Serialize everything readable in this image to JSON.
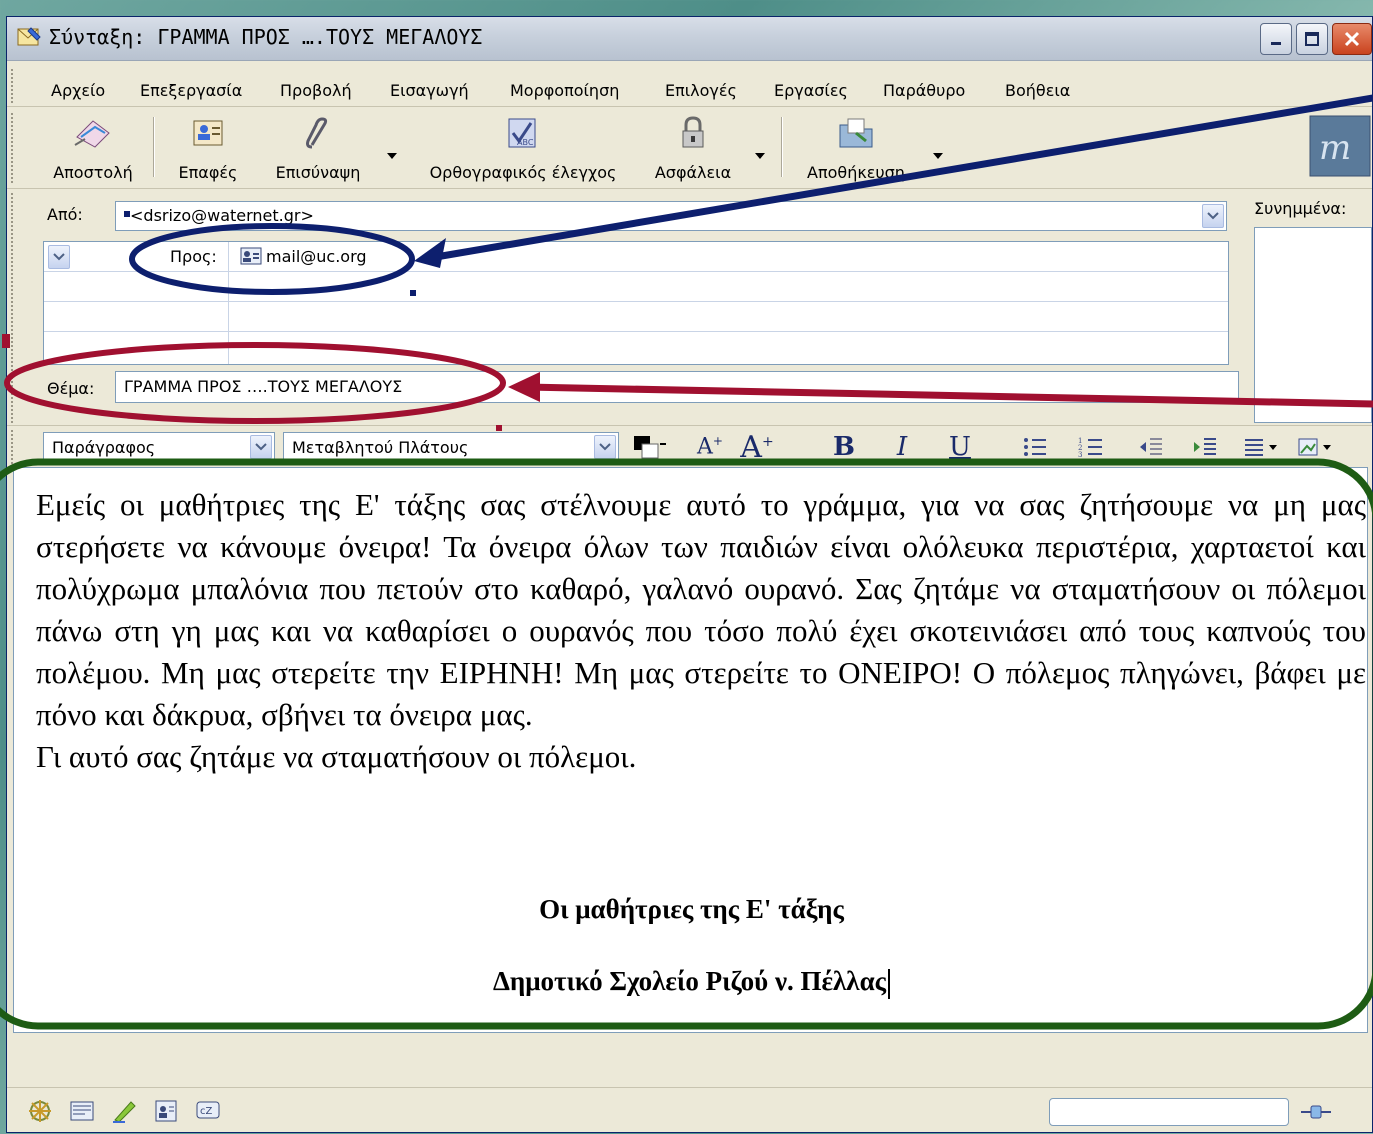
{
  "window": {
    "title": "Σύνταξη: ΓΡΑΜΜΑ ΠΡΟΣ ….ΤΟΥΣ ΜΕΓΑΛΟΥΣ"
  },
  "menu": [
    "Αρχείο",
    "Επεξεργασία",
    "Προβολή",
    "Εισαγωγή",
    "Μορφοποίηση",
    "Επιλογές",
    "Εργασίες",
    "Παράθυρο",
    "Βοήθεια"
  ],
  "toolbar": {
    "send": "Αποστολή",
    "contacts": "Επαφές",
    "attach": "Επισύναψη",
    "spell": "Ορθογραφικός έλεγχος",
    "security": "Ασφάλεια",
    "save": "Αποθήκευση"
  },
  "header": {
    "from_label": "Από:",
    "from_value": "<dsrizo@waternet.gr>",
    "to_label": "Προς:",
    "to_value": "mail@uc.org",
    "subject_label": "Θέμα:",
    "subject_value": "ΓΡΑΜΜΑ ΠΡΟΣ ….ΤΟΥΣ ΜΕΓΑΛΟΥΣ",
    "attachments_label": "Συνημμένα:"
  },
  "format": {
    "paragraph": "Παράγραφος",
    "font": "Μεταβλητού Πλάτους"
  },
  "body": {
    "text": "Εμείς οι μαθήτριες της Ε' τάξης σας στέλνουμε αυτό το γράμμα, για να σας ζητήσουμε να μη μας στερήσετε να κάνουμε όνειρα! Τα όνειρα όλων των παιδιών είναι ολόλευκα περιστέρια, χαρταετοί και πολύχρωμα μπαλόνια που πετούν στο καθαρό, γαλανό ουρανό. Σας ζητάμε να σταματήσουν οι πόλεμοι πάνω στη γη μας και να καθαρίσει ο ουρανός που τόσο πολύ έχει σκοτεινιάσει από τους καπνούς του πολέμου. Μη μας στερείτε την ΕΙΡΗΝΗ! Μη μας στερείτε το ΟΝΕΙΡΟ! Ο πόλεμος πληγώνει, βάφει με πόνο και δάκρυα, σβήνει τα όνειρα μας.",
    "line2": "Γι αυτό σας ζητάμε να σταματήσουν οι πόλεμοι.",
    "signature1": "Οι μαθήτριες της Ε' τάξης",
    "signature2": "Δημοτικό Σχολείο Ριζού ν. Πέλλας"
  },
  "colors": {
    "annotation_blue": "#0d1f6e",
    "annotation_red": "#a01030",
    "annotation_green": "#1e5c14"
  }
}
